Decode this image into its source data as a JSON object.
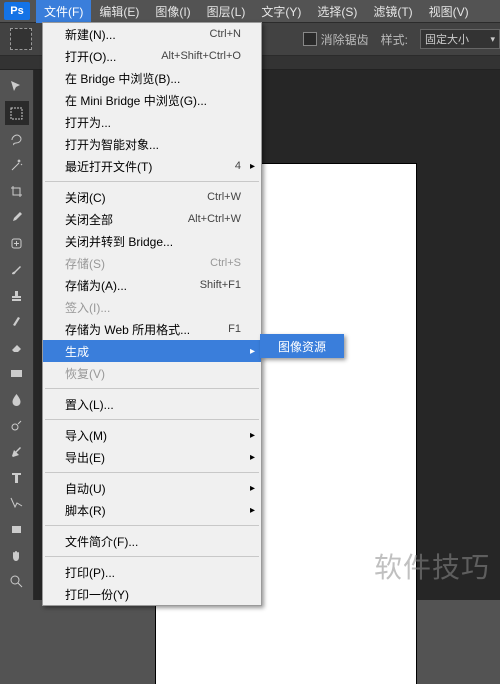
{
  "logo": "Ps",
  "menubar": [
    "文件(F)",
    "编辑(E)",
    "图像(I)",
    "图层(L)",
    "文字(Y)",
    "选择(S)",
    "滤镜(T)",
    "视图(V)"
  ],
  "menubar_open_index": 0,
  "optionsbar": {
    "antialias_label": "消除锯齿",
    "style_label": "样式:",
    "style_value": "固定大小"
  },
  "file_menu": [
    {
      "t": "item",
      "label": "新建(N)...",
      "sc": "Ctrl+N"
    },
    {
      "t": "item",
      "label": "打开(O)...",
      "sc": "Alt+Shift+Ctrl+O"
    },
    {
      "t": "item",
      "label": "在 Bridge 中浏览(B)..."
    },
    {
      "t": "item",
      "label": "在 Mini Bridge 中浏览(G)..."
    },
    {
      "t": "item",
      "label": "打开为..."
    },
    {
      "t": "item",
      "label": "打开为智能对象..."
    },
    {
      "t": "item",
      "label": "最近打开文件(T)",
      "sc": "4",
      "sub": true
    },
    {
      "t": "sep"
    },
    {
      "t": "item",
      "label": "关闭(C)",
      "sc": "Ctrl+W"
    },
    {
      "t": "item",
      "label": "关闭全部",
      "sc": "Alt+Ctrl+W"
    },
    {
      "t": "item",
      "label": "关闭并转到 Bridge..."
    },
    {
      "t": "item",
      "label": "存储(S)",
      "sc": "Ctrl+S",
      "dis": true
    },
    {
      "t": "item",
      "label": "存储为(A)...",
      "sc": "Shift+F1"
    },
    {
      "t": "item",
      "label": "签入(I)...",
      "dis": true
    },
    {
      "t": "item",
      "label": "存储为 Web 所用格式...",
      "sc": "F1"
    },
    {
      "t": "item",
      "label": "生成",
      "sub": true,
      "hot": true
    },
    {
      "t": "item",
      "label": "恢复(V)",
      "dis": true
    },
    {
      "t": "sep"
    },
    {
      "t": "item",
      "label": "置入(L)..."
    },
    {
      "t": "sep"
    },
    {
      "t": "item",
      "label": "导入(M)",
      "sub": true
    },
    {
      "t": "item",
      "label": "导出(E)",
      "sub": true
    },
    {
      "t": "sep"
    },
    {
      "t": "item",
      "label": "自动(U)",
      "sub": true
    },
    {
      "t": "item",
      "label": "脚本(R)",
      "sub": true
    },
    {
      "t": "sep"
    },
    {
      "t": "item",
      "label": "文件简介(F)..."
    },
    {
      "t": "sep"
    },
    {
      "t": "item",
      "label": "打印(P)..."
    },
    {
      "t": "item",
      "label": "打印一份(Y)"
    }
  ],
  "submenu": {
    "label": "图像资源"
  },
  "tools": [
    "move",
    "marquee",
    "lasso",
    "wand",
    "crop",
    "eyedrop",
    "heal",
    "brush",
    "stamp",
    "history",
    "eraser",
    "gradient",
    "blur",
    "dodge",
    "pen",
    "type",
    "path",
    "rect",
    "hand",
    "zoom"
  ],
  "tools_selected_index": 1,
  "watermark": "软件技巧"
}
